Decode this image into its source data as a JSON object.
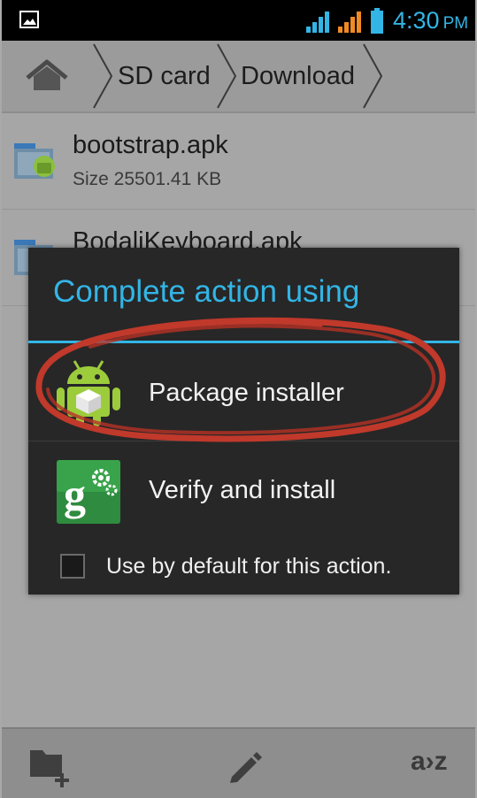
{
  "status_bar": {
    "time": "4:30",
    "ampm": "PM"
  },
  "breadcrumb": {
    "items": [
      "SD card",
      "Download"
    ]
  },
  "files": [
    {
      "name": "bootstrap.apk",
      "size": "Size 25501.41 KB"
    },
    {
      "name": "BodaliKeyboard.apk"
    }
  ],
  "dialog": {
    "title": "Complete action using",
    "options": [
      {
        "label": "Package installer",
        "icon": "android-package-icon"
      },
      {
        "label": "Verify and install",
        "icon": "google-settings-icon"
      }
    ],
    "default_label": "Use by default for this action."
  },
  "toolbar": {
    "sort_label": "a›z"
  },
  "colors": {
    "accent": "#33b5e5",
    "dialog_bg": "#272727",
    "annotation": "#c0392b"
  }
}
